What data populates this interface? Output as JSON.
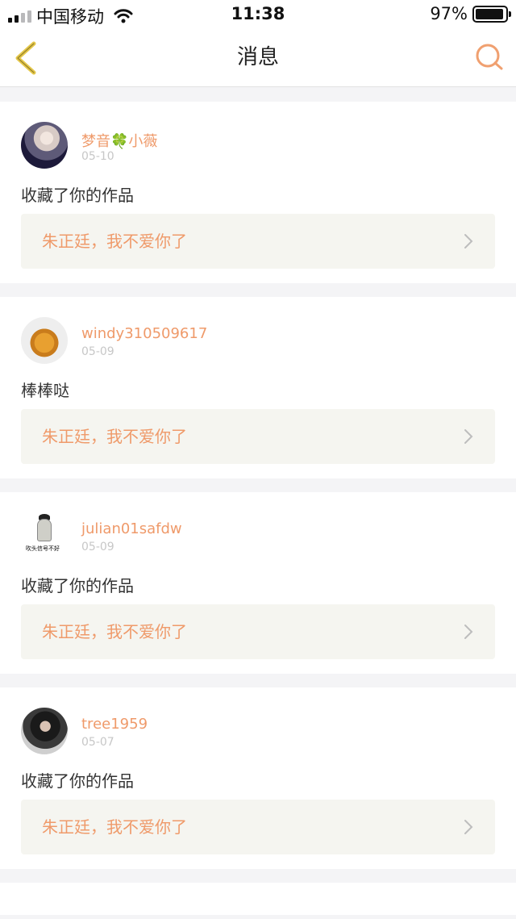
{
  "status_bar": {
    "carrier": "中国移动",
    "time": "11:38",
    "battery_percent": "97%",
    "battery_level": 0.97
  },
  "navbar": {
    "title": "消息",
    "back_icon": "chevron-left-icon",
    "search_icon": "search-icon",
    "accent_color": "#ef9a6a"
  },
  "messages": [
    {
      "username": "梦音🍀小薇",
      "date": "05-10",
      "content": "收藏了你的作品",
      "work_title": "朱正廷，我不爱你了"
    },
    {
      "username": "windy310509617",
      "date": "05-09",
      "content": "棒棒哒",
      "work_title": "朱正廷，我不爱你了"
    },
    {
      "username": "julian01safdw",
      "date": "05-09",
      "avatar_text": "吹头信号不好",
      "content": "收藏了你的作品",
      "work_title": "朱正廷，我不爱你了"
    },
    {
      "username": "tree1959",
      "date": "05-07",
      "content": "收藏了你的作品",
      "work_title": "朱正廷，我不爱你了"
    }
  ]
}
